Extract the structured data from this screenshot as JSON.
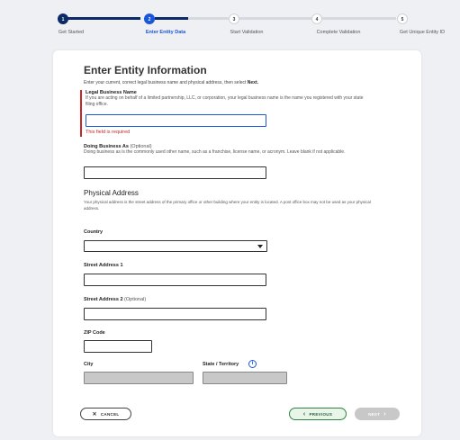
{
  "stepper": {
    "steps": [
      {
        "number": "1",
        "label": "Get Started"
      },
      {
        "number": "2",
        "label": "Enter Entity Data"
      },
      {
        "number": "3",
        "label": "Start Validation"
      },
      {
        "number": "4",
        "label": "Complete Validation"
      },
      {
        "number": "5",
        "label": "Get Unique Entity ID"
      }
    ]
  },
  "form": {
    "title": "Enter Entity Information",
    "intro_prefix": "Enter your current, correct legal business name and physical address, then select ",
    "intro_bold": "Next.",
    "legal_name": {
      "label": "Legal Business Name",
      "help": "If you are acting on behalf of a limited partnership, LLC, or corporation, your legal business name is the name you registered with your state filing office.",
      "error": "This field is required",
      "value": ""
    },
    "dba": {
      "label": "Doing Business As",
      "optional": "(Optional)",
      "help": "Doing business as is the commonly used other name, such as a franchise, license name, or acronym. Leave blank if not applicable.",
      "value": ""
    },
    "physical_address": {
      "title": "Physical Address",
      "help": "Your physical address is the street address of the primary office or other building where your entity is located. A post office box may not be used as your physical address."
    },
    "country": {
      "label": "Country",
      "value": ""
    },
    "street1": {
      "label": "Street Address 1",
      "value": ""
    },
    "street2": {
      "label": "Street Address 2",
      "optional": "(Optional)",
      "value": ""
    },
    "zip": {
      "label": "ZIP Code",
      "value": ""
    },
    "city": {
      "label": "City",
      "value": ""
    },
    "state": {
      "label": "State / Territory",
      "value": ""
    }
  },
  "buttons": {
    "cancel": "CANCEL",
    "previous": "PREVIOUS",
    "next": "NEXT"
  },
  "colors": {
    "primary": "#1a56db",
    "complete": "#0b2a66",
    "error": "#c62828",
    "success": "#2e8540"
  }
}
